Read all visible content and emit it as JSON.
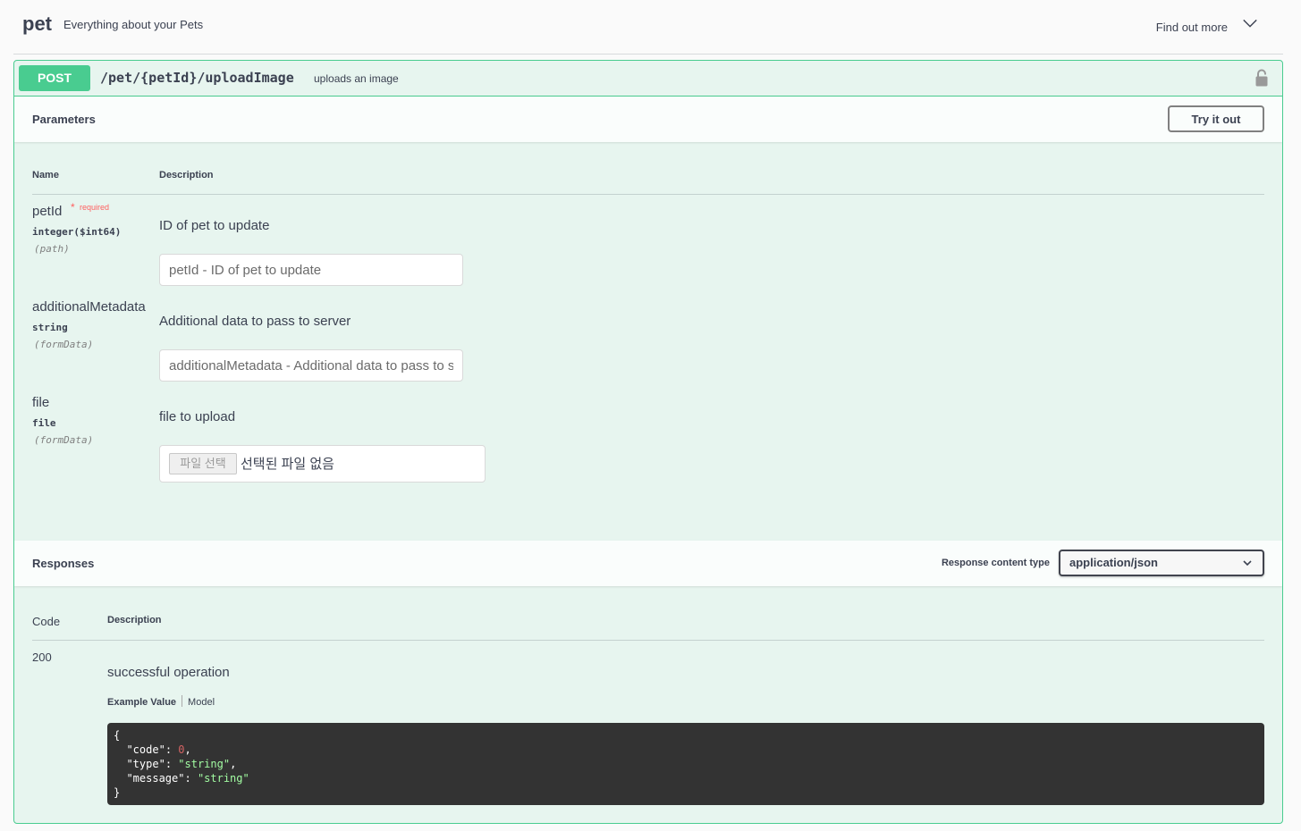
{
  "tag": {
    "name": "pet",
    "description": "Everything about your Pets",
    "find_out_more": "Find out more"
  },
  "operation": {
    "method": "POST",
    "path": "/pet/{petId}/uploadImage",
    "summary": "uploads an image",
    "colors": {
      "accent": "#49cc90"
    }
  },
  "parameters": {
    "title": "Parameters",
    "try_it_out": "Try it out",
    "col_name": "Name",
    "col_description": "Description",
    "items": [
      {
        "name": "petId",
        "required": "required",
        "type": "integer($int64)",
        "in": "(path)",
        "description": "ID of pet to update",
        "placeholder": "petId - ID of pet to update"
      },
      {
        "name": "additionalMetadata",
        "type": "string",
        "in": "(formData)",
        "description": "Additional data to pass to server",
        "placeholder": "additionalMetadata - Additional data to pass to server"
      },
      {
        "name": "file",
        "type": "file",
        "in": "(formData)",
        "description": "file to upload",
        "file_button": "파일 선택",
        "file_status": "선택된 파일 없음"
      }
    ]
  },
  "responses": {
    "title": "Responses",
    "content_type_label": "Response content type",
    "content_type_value": "application/json",
    "col_code": "Code",
    "col_description": "Description",
    "items": [
      {
        "code": "200",
        "description": "successful operation",
        "tab_example": "Example Value",
        "tab_model": "Model",
        "example": {
          "open": "{",
          "close": "}",
          "code_key": "\"code\"",
          "code_val": "0",
          "type_key": "\"type\"",
          "type_val": "\"string\"",
          "message_key": "\"message\"",
          "message_val": "\"string\""
        }
      }
    ]
  }
}
